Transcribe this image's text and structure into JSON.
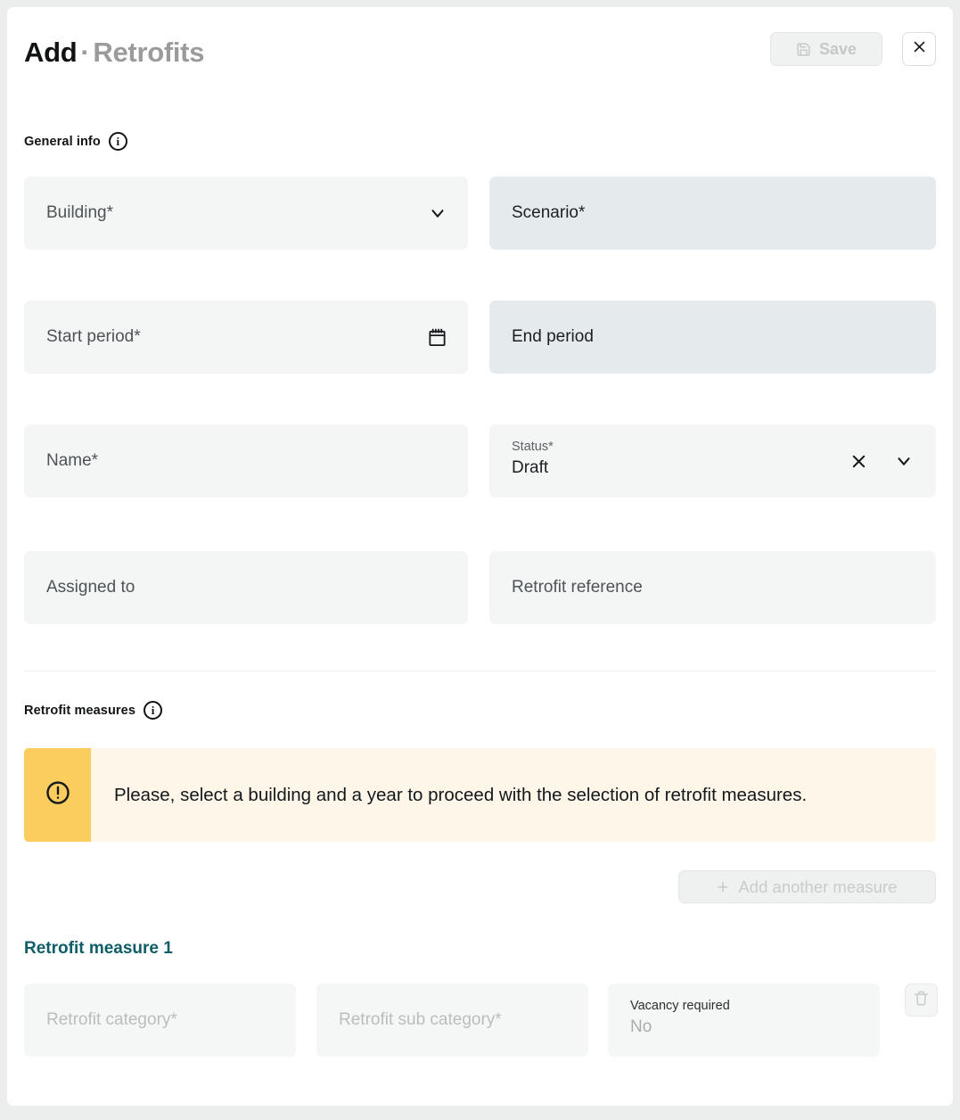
{
  "header": {
    "title_main": "Add",
    "title_separator": "·",
    "title_sub": "Retrofits",
    "save_label": "Save",
    "save_icon": "save-floppy-icon",
    "close_icon": "close-icon"
  },
  "general_info": {
    "heading": "General info",
    "info_icon": "info-circle-icon",
    "fields": [
      {
        "label": "Building*",
        "value": "",
        "state": "default",
        "trailing_icon": "chevron-down-icon"
      },
      {
        "label": "Scenario*",
        "value": "",
        "state": "tinted",
        "trailing_icon": ""
      },
      {
        "label": "Start period*",
        "value": "",
        "state": "default",
        "trailing_icon": "calendar-icon"
      },
      {
        "label": "End period",
        "value": "",
        "state": "tinted",
        "trailing_icon": ""
      },
      {
        "label": "Name*",
        "value": "",
        "state": "default",
        "trailing_icon": ""
      },
      {
        "label": "Status*",
        "value": "Draft",
        "state": "default",
        "trailing_icon": "clear-and-chevron"
      },
      {
        "label": "Assigned to",
        "value": "",
        "state": "default",
        "trailing_icon": ""
      },
      {
        "label": "Retrofit reference",
        "value": "",
        "state": "default",
        "trailing_icon": ""
      }
    ]
  },
  "retrofit_measures": {
    "heading": "Retrofit measures",
    "info_icon": "info-circle-icon",
    "warning": {
      "icon": "alert-circle-icon",
      "text": "Please, select a building and a year to proceed with the selection of retrofit measures."
    },
    "add_button": {
      "label": "Add another measure",
      "icon": "plus-icon",
      "disabled": true
    },
    "measure_title": "Retrofit measure 1",
    "measure_fields": [
      {
        "label": "Retrofit category*",
        "value": ""
      },
      {
        "label": "Retrofit sub category*",
        "value": ""
      },
      {
        "label": "Vacancy required",
        "value": "No"
      }
    ],
    "delete_icon": "trash-icon"
  },
  "colors": {
    "accent_teal": "#0f5d66",
    "warning_strip": "#fbcd5f",
    "warning_bg": "#fdf6e9",
    "field_bg": "#f4f6f6",
    "field_tinted_bg": "#e5ebed",
    "page_bg": "#eceded"
  }
}
